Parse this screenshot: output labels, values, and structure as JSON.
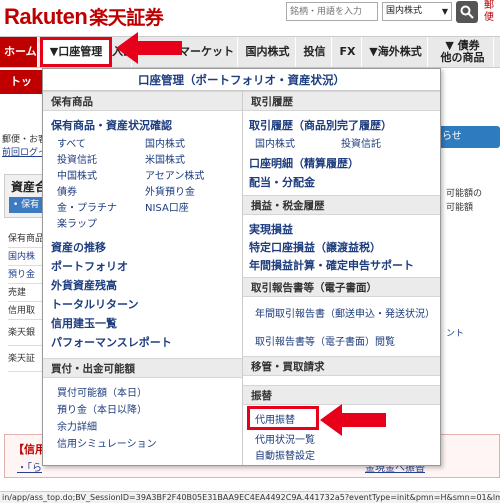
{
  "header": {
    "logo_text": "Rakuten",
    "logo_jp": "楽天証券",
    "search_placeholder": "銘柄・用語を入力",
    "market_select": "国内株式",
    "search_icon": "🔍",
    "corner_text": "郵便"
  },
  "nav": {
    "home": "ホーム",
    "account": "▼口座管理",
    "kabu": "入出",
    "market": "マーケット",
    "domestic": "国内株式",
    "trust": "投信",
    "fx": "FX",
    "foreign": "▼海外株式",
    "bond_line1": "▼ 債券",
    "bond_line2": "他の商品"
  },
  "background": {
    "sub_tab": "トップ",
    "welcome": "郵便・お客様",
    "last_login": "前回ログイン",
    "asset_title": "資産合",
    "hold_button": "• 保有",
    "table_rows": [
      "保有商品",
      "国内株",
      "預り金",
      "売建",
      "信用取",
      "楽天銀",
      "楽天証"
    ],
    "right_button": "らせ",
    "right_texts": [
      "可能額の",
      "可能額",
      "ント"
    ],
    "notice_title": "【信用取",
    "notice_link_left": "・「ら",
    "notice_link_right": "金現金へ振替",
    "status_bar": "in/app/ass_top.do;BV_SessionID=39A3BF2F40B05E31BAA9EC4EA4492C9A.441732a5?eventType=init&pmn=H&smn=01&lmn=&sm"
  },
  "dropdown": {
    "title": "口座管理（ポートフォリオ・資産状況）",
    "left": {
      "holdings_header": "保有商品",
      "holdings_main": "保有商品・資産状況確認",
      "holdings_links": [
        [
          "すべて",
          "国内株式"
        ],
        [
          "投資信託",
          "米国株式"
        ],
        [
          "中国株式",
          "アセアン株式"
        ],
        [
          "債券",
          "外貨預り金"
        ],
        [
          "金・プラチナ",
          "NISA口座"
        ],
        [
          "楽ラップ",
          ""
        ]
      ],
      "holdings_bold": [
        "資産の推移",
        "ポートフォリオ",
        "外貨資産残高",
        "トータルリターン",
        "信用建玉一覧",
        "パフォーマンスレポート"
      ],
      "buying_header": "買付・出金可能額",
      "buying_links": [
        "買付可能額（本日）",
        "預り金（本日以降）",
        "余力詳細",
        "信用シミュレーション"
      ]
    },
    "right": {
      "history_header": "取引履歴",
      "history_main": "取引履歴（商品別完了履歴）",
      "history_sub": [
        "国内株式",
        "投資信託"
      ],
      "history_bold": [
        "口座明細（精算履歴）",
        "配当・分配金"
      ],
      "tax_header": "損益・税金履歴",
      "tax_bold": [
        "実現損益",
        "特定口座損益（譲渡益税）",
        "年間損益計算・確定申告サポート"
      ],
      "report_header": "取引報告書等（電子書面）",
      "report_links": [
        "年間取引報告書（郵送申込・発送状況）",
        "取引報告書等（電子書面）閲覧"
      ],
      "transfer_header": "移管・買取請求",
      "furikae_header": "振替",
      "furikae_links": [
        "代用振替",
        "代用状況一覧",
        "自動振替設定"
      ]
    }
  },
  "colors": {
    "brand_red": "#bf0000",
    "annotation_red": "#e8001a",
    "link_blue": "#1d3d7e",
    "section_gray": "#ebebeb"
  }
}
